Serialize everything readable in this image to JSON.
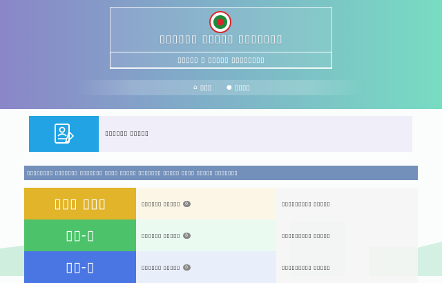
{
  "header": {
    "emblem_icon": "bangladesh-government-seal",
    "title": "▯▯▯▯▯▯ ▯▯▯▯▯ ▯▯▯▯▯▯▯",
    "subtitle": "▯▯▯▯▯ ▯ ▯▯▯▯▯ ▯▯▯▯▯▯▯▯"
  },
  "nav": {
    "items": [
      {
        "icon": "home-icon",
        "label": "▯▯▯"
      },
      {
        "icon": "globe-icon",
        "label": "▯▯▯▯"
      }
    ]
  },
  "login_card": {
    "icon": "user-document-icon",
    "label": "▯▯▯▯▯▯ ▯▯▯▯▯"
  },
  "notice": "▯▯▯▯▯▯▯▯ ▯▯▯▯▯▯▯ ▯▯▯▯▯▯▯ ▯▯▯▯ ▯▯▯▯▯ ▯▯▯▯▯▯▯ ▯▯▯▯▯ ▯▯▯▯ ▯▯▯▯▯ ▯▯▯▯▯▯▯",
  "rows": [
    {
      "label": "▯▯▯ ▯▯▯",
      "color": "#e2b42a",
      "cell1_bg": "#fbf6e6",
      "cell1_text": "▯▯▯▯▯▯ ▯▯▯▯▯",
      "badge": "0",
      "cell2_text": "▯▯▯▯▯▯▯▯▯ ▯▯▯▯▯"
    },
    {
      "label": "▯▯-▯",
      "color": "#4cc36a",
      "cell1_bg": "#eafaf0",
      "cell1_text": "▯▯▯▯▯▯ ▯▯▯▯▯",
      "badge": "0",
      "cell2_text": "▯▯▯▯▯▯▯▯▯ ▯▯▯▯▯"
    },
    {
      "label": "▯▯-▯",
      "color": "#4a76e3",
      "cell1_bg": "#e9eefb",
      "cell1_text": "▯▯▯▯▯▯ ▯▯▯▯▯",
      "badge": "0",
      "cell2_text": "▯▯▯▯▯▯▯▯▯ ▯▯▯▯▯"
    }
  ]
}
